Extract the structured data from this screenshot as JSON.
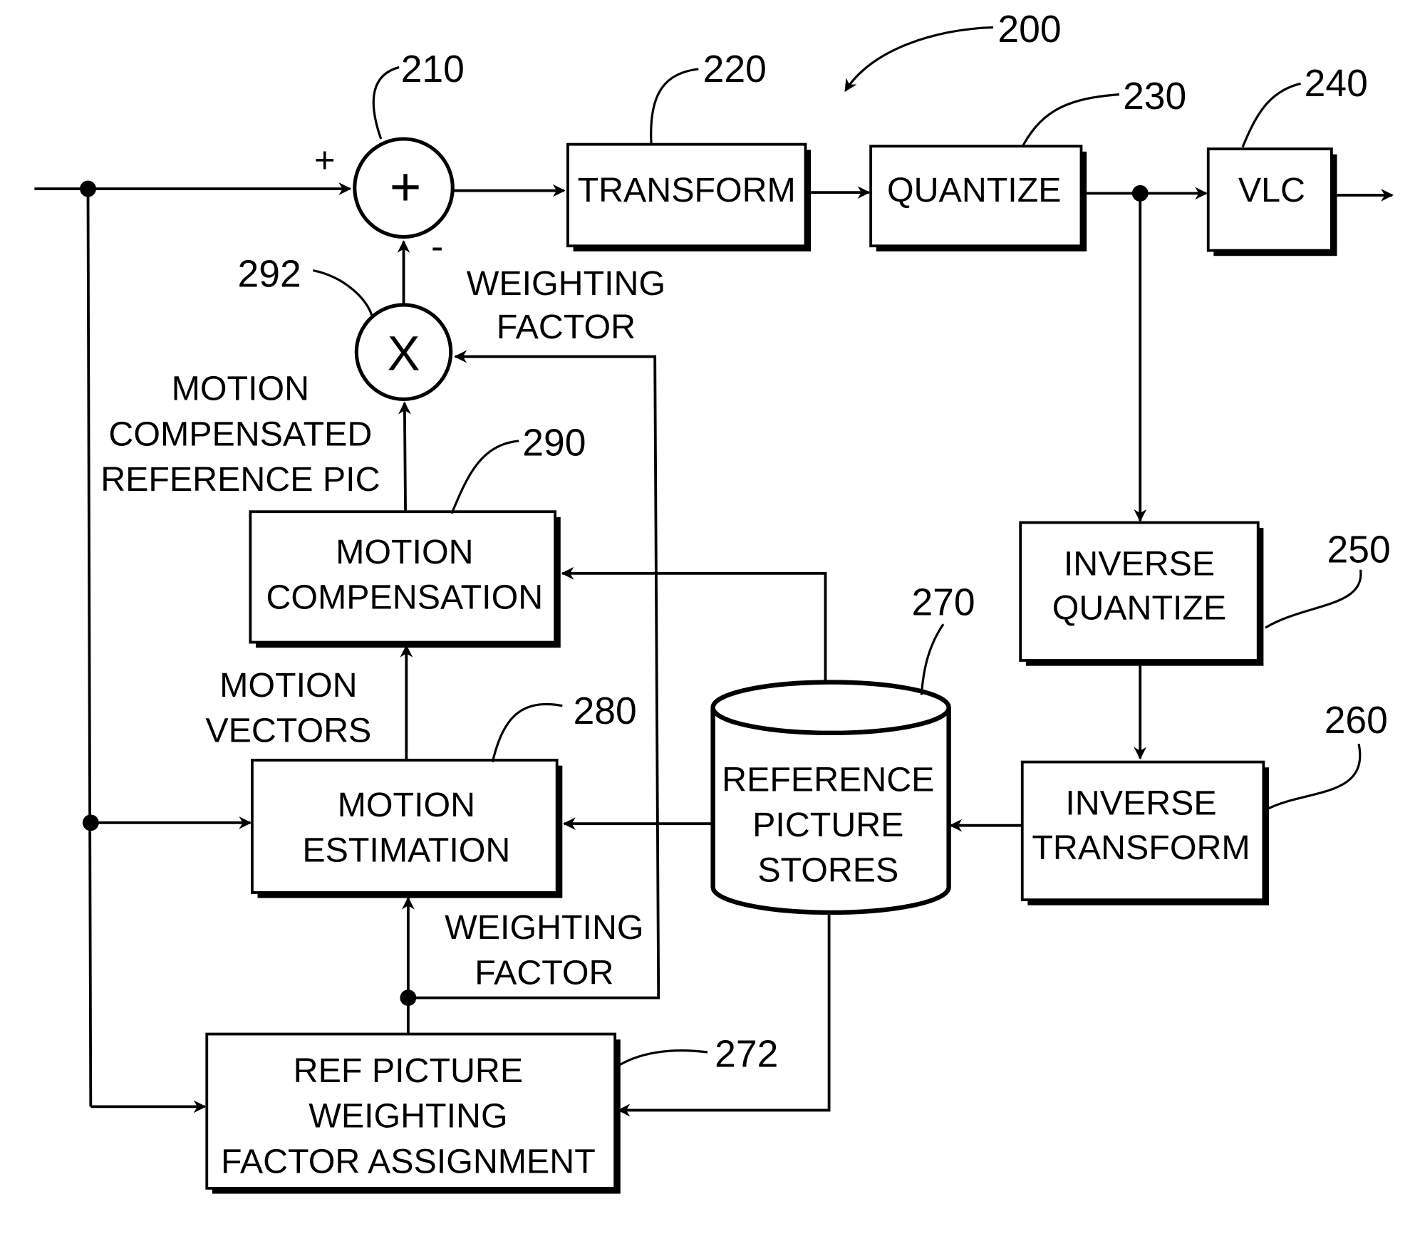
{
  "figure": {
    "reference": "200",
    "blocks": {
      "adder": {
        "ref": "210",
        "symbol": "+",
        "plus_sign": "+",
        "minus_sign": "-"
      },
      "transform": {
        "ref": "220",
        "label": "TRANSFORM"
      },
      "quantize": {
        "ref": "230",
        "label": "QUANTIZE"
      },
      "vlc": {
        "ref": "240",
        "label": "VLC"
      },
      "inverse_quantize": {
        "ref": "250",
        "lines": [
          "INVERSE",
          "QUANTIZE"
        ]
      },
      "inverse_transform": {
        "ref": "260",
        "lines": [
          "INVERSE",
          "TRANSFORM"
        ]
      },
      "reference_picture_stores": {
        "ref": "270",
        "lines": [
          "REFERENCE",
          "PICTURE",
          "STORES"
        ]
      },
      "ref_picture_weighting": {
        "ref": "272",
        "lines": [
          "REF PICTURE",
          "WEIGHTING",
          "FACTOR ASSIGNMENT"
        ]
      },
      "motion_estimation": {
        "ref": "280",
        "lines": [
          "MOTION",
          "ESTIMATION"
        ]
      },
      "motion_compensation": {
        "ref": "290",
        "lines": [
          "MOTION",
          "COMPENSATION"
        ]
      },
      "multiplier": {
        "ref": "292",
        "symbol": "X"
      }
    },
    "signal_labels": {
      "weighting_factor_top": [
        "WEIGHTING",
        "FACTOR"
      ],
      "motion_compensated": [
        "MOTION",
        "COMPENSATED",
        "REFERENCE PIC"
      ],
      "motion_vectors": [
        "MOTION",
        "VECTORS"
      ],
      "weighting_factor_bottom": [
        "WEIGHTING",
        "FACTOR"
      ]
    }
  }
}
